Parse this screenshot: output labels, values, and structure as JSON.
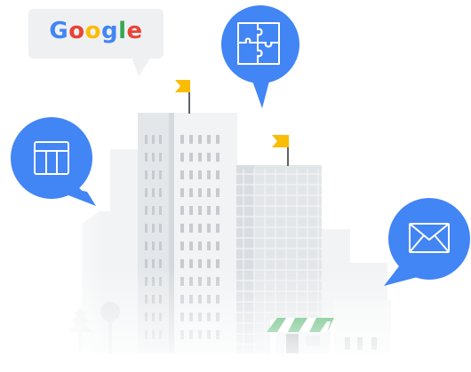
{
  "logo": {
    "letters": [
      {
        "char": "G",
        "color": "#4285F4"
      },
      {
        "char": "o",
        "color": "#EA4335"
      },
      {
        "char": "o",
        "color": "#FBBC05"
      },
      {
        "char": "g",
        "color": "#4285F4"
      },
      {
        "char": "l",
        "color": "#34A853"
      },
      {
        "char": "e",
        "color": "#EA4335"
      }
    ]
  },
  "colors": {
    "accent_blue": "#4285F4",
    "flag_yellow": "#FBBC04",
    "awning_green": "#34A853",
    "building_light": "#eceff1",
    "building_mid": "#dfe2e5",
    "window": "#c7cbcf"
  },
  "icons": {
    "puzzle": "puzzle-icon",
    "table": "table-icon",
    "mail": "mail-icon"
  }
}
